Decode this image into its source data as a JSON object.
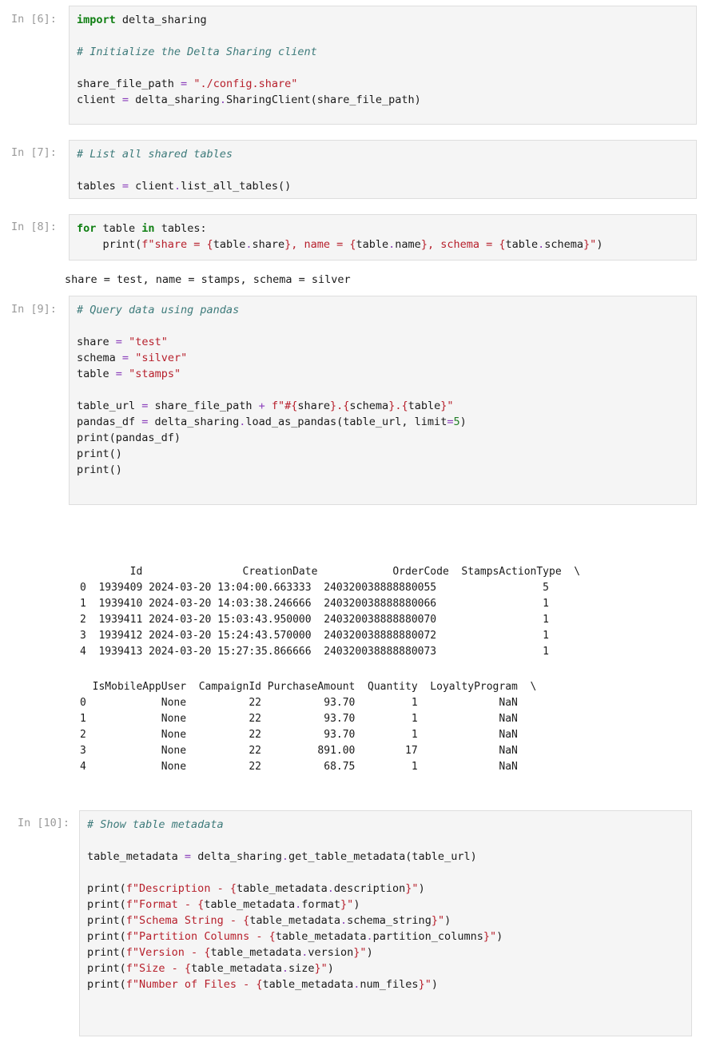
{
  "cells": [
    {
      "prompt": "In [6]:",
      "lines": [
        [
          {
            "t": "import",
            "c": "kw"
          },
          {
            "t": " delta_sharing",
            "c": ""
          }
        ],
        [],
        [
          {
            "t": "# Initialize the Delta Sharing client",
            "c": "cm"
          }
        ],
        [],
        [
          {
            "t": "share_file_path ",
            "c": ""
          },
          {
            "t": "=",
            "c": "op"
          },
          {
            "t": " ",
            "c": ""
          },
          {
            "t": "\"./config.share\"",
            "c": "st"
          }
        ],
        [
          {
            "t": "client ",
            "c": ""
          },
          {
            "t": "=",
            "c": "op"
          },
          {
            "t": " delta_sharing",
            "c": ""
          },
          {
            "t": ".",
            "c": "op"
          },
          {
            "t": "SharingClient(share_file_path)",
            "c": ""
          }
        ]
      ]
    },
    {
      "prompt": "In [7]:",
      "lines": [
        [
          {
            "t": "# List all shared tables",
            "c": "cm"
          }
        ],
        [],
        [
          {
            "t": "tables ",
            "c": ""
          },
          {
            "t": "=",
            "c": "op"
          },
          {
            "t": " client",
            "c": ""
          },
          {
            "t": ".",
            "c": "op"
          },
          {
            "t": "list_all_tables()",
            "c": ""
          }
        ]
      ]
    },
    {
      "prompt": "In [8]:",
      "lines": [
        [
          {
            "t": "for",
            "c": "kw"
          },
          {
            "t": " table ",
            "c": ""
          },
          {
            "t": "in",
            "c": "kw"
          },
          {
            "t": " tables:",
            "c": ""
          }
        ],
        [
          {
            "t": "    print(",
            "c": ""
          },
          {
            "t": "f\"share = {",
            "c": "st"
          },
          {
            "t": "table",
            "c": ""
          },
          {
            "t": ".",
            "c": "op"
          },
          {
            "t": "share",
            "c": ""
          },
          {
            "t": "}, name = {",
            "c": "st"
          },
          {
            "t": "table",
            "c": ""
          },
          {
            "t": ".",
            "c": "op"
          },
          {
            "t": "name",
            "c": ""
          },
          {
            "t": "}, schema = {",
            "c": "st"
          },
          {
            "t": "table",
            "c": ""
          },
          {
            "t": ".",
            "c": "op"
          },
          {
            "t": "schema",
            "c": ""
          },
          {
            "t": "}\"",
            "c": "st"
          },
          {
            "t": ")",
            "c": ""
          }
        ]
      ]
    },
    {
      "prompt": "In [9]:",
      "lines": [
        [
          {
            "t": "# Query data using pandas",
            "c": "cm"
          }
        ],
        [],
        [
          {
            "t": "share ",
            "c": ""
          },
          {
            "t": "=",
            "c": "op"
          },
          {
            "t": " ",
            "c": ""
          },
          {
            "t": "\"test\"",
            "c": "st"
          }
        ],
        [
          {
            "t": "schema ",
            "c": ""
          },
          {
            "t": "=",
            "c": "op"
          },
          {
            "t": " ",
            "c": ""
          },
          {
            "t": "\"silver\"",
            "c": "st"
          }
        ],
        [
          {
            "t": "table ",
            "c": ""
          },
          {
            "t": "=",
            "c": "op"
          },
          {
            "t": " ",
            "c": ""
          },
          {
            "t": "\"stamps\"",
            "c": "st"
          }
        ],
        [],
        [
          {
            "t": "table_url ",
            "c": ""
          },
          {
            "t": "=",
            "c": "op"
          },
          {
            "t": " share_file_path ",
            "c": ""
          },
          {
            "t": "+",
            "c": "op"
          },
          {
            "t": " ",
            "c": ""
          },
          {
            "t": "f\"#{",
            "c": "st"
          },
          {
            "t": "share",
            "c": ""
          },
          {
            "t": "}.{",
            "c": "st"
          },
          {
            "t": "schema",
            "c": ""
          },
          {
            "t": "}.{",
            "c": "st"
          },
          {
            "t": "table",
            "c": ""
          },
          {
            "t": "}\"",
            "c": "st"
          }
        ],
        [
          {
            "t": "pandas_df ",
            "c": ""
          },
          {
            "t": "=",
            "c": "op"
          },
          {
            "t": " delta_sharing",
            "c": ""
          },
          {
            "t": ".",
            "c": "op"
          },
          {
            "t": "load_as_pandas(table_url, limit",
            "c": ""
          },
          {
            "t": "=",
            "c": "op"
          },
          {
            "t": "5",
            "c": "nm"
          },
          {
            "t": ")",
            "c": ""
          }
        ],
        [
          {
            "t": "print(pandas_df)",
            "c": ""
          }
        ],
        [
          {
            "t": "print()",
            "c": ""
          }
        ],
        [
          {
            "t": "print()",
            "c": ""
          }
        ]
      ]
    },
    {
      "prompt": "In [10]:",
      "lines": [
        [
          {
            "t": "# Show table metadata",
            "c": "cm"
          }
        ],
        [],
        [
          {
            "t": "table_metadata ",
            "c": ""
          },
          {
            "t": "=",
            "c": "op"
          },
          {
            "t": " delta_sharing",
            "c": ""
          },
          {
            "t": ".",
            "c": "op"
          },
          {
            "t": "get_table_metadata(table_url)",
            "c": ""
          }
        ],
        [],
        [
          {
            "t": "print(",
            "c": ""
          },
          {
            "t": "f\"Description - {",
            "c": "st"
          },
          {
            "t": "table_metadata",
            "c": ""
          },
          {
            "t": ".",
            "c": "op"
          },
          {
            "t": "description",
            "c": ""
          },
          {
            "t": "}\"",
            "c": "st"
          },
          {
            "t": ")",
            "c": ""
          }
        ],
        [
          {
            "t": "print(",
            "c": ""
          },
          {
            "t": "f\"Format - {",
            "c": "st"
          },
          {
            "t": "table_metadata",
            "c": ""
          },
          {
            "t": ".",
            "c": "op"
          },
          {
            "t": "format",
            "c": ""
          },
          {
            "t": "}\"",
            "c": "st"
          },
          {
            "t": ")",
            "c": ""
          }
        ],
        [
          {
            "t": "print(",
            "c": ""
          },
          {
            "t": "f\"Schema String - {",
            "c": "st"
          },
          {
            "t": "table_metadata",
            "c": ""
          },
          {
            "t": ".",
            "c": "op"
          },
          {
            "t": "schema_string",
            "c": ""
          },
          {
            "t": "}\"",
            "c": "st"
          },
          {
            "t": ")",
            "c": ""
          }
        ],
        [
          {
            "t": "print(",
            "c": ""
          },
          {
            "t": "f\"Partition Columns - {",
            "c": "st"
          },
          {
            "t": "table_metadata",
            "c": ""
          },
          {
            "t": ".",
            "c": "op"
          },
          {
            "t": "partition_columns",
            "c": ""
          },
          {
            "t": "}\"",
            "c": "st"
          },
          {
            "t": ")",
            "c": ""
          }
        ],
        [
          {
            "t": "print(",
            "c": ""
          },
          {
            "t": "f\"Version - {",
            "c": "st"
          },
          {
            "t": "table_metadata",
            "c": ""
          },
          {
            "t": ".",
            "c": "op"
          },
          {
            "t": "version",
            "c": ""
          },
          {
            "t": "}\"",
            "c": "st"
          },
          {
            "t": ")",
            "c": ""
          }
        ],
        [
          {
            "t": "print(",
            "c": ""
          },
          {
            "t": "f\"Size - {",
            "c": "st"
          },
          {
            "t": "table_metadata",
            "c": ""
          },
          {
            "t": ".",
            "c": "op"
          },
          {
            "t": "size",
            "c": ""
          },
          {
            "t": "}\"",
            "c": "st"
          },
          {
            "t": ")",
            "c": ""
          }
        ],
        [
          {
            "t": "print(",
            "c": ""
          },
          {
            "t": "f\"Number of Files - {",
            "c": "st"
          },
          {
            "t": "table_metadata",
            "c": ""
          },
          {
            "t": ".",
            "c": "op"
          },
          {
            "t": "num_files",
            "c": ""
          },
          {
            "t": "}\"",
            "c": "st"
          },
          {
            "t": ")",
            "c": ""
          }
        ]
      ]
    }
  ],
  "outputs": {
    "cell8": "share = test, name = stamps, schema = silver",
    "cell9_table1": [
      "        Id                CreationDate            OrderCode  StampsActionType  \\",
      "0  1939409 2024-03-20 13:04:00.663333  240320038888880055                 5",
      "1  1939410 2024-03-20 14:03:38.246666  240320038888880066                 1",
      "2  1939411 2024-03-20 15:03:43.950000  240320038888880070                 1",
      "3  1939412 2024-03-20 15:24:43.570000  240320038888880072                 1",
      "4  1939413 2024-03-20 15:27:35.866666  240320038888880073                 1"
    ],
    "cell9_table2": [
      "  IsMobileAppUser  CampaignId PurchaseAmount  Quantity  LoyaltyProgram  \\",
      "0            None          22          93.70         1             NaN",
      "1            None          22          93.70         1             NaN",
      "2            None          22          93.70         1             NaN",
      "3            None          22         891.00        17             NaN",
      "4            None          22          68.75         1             NaN"
    ]
  }
}
